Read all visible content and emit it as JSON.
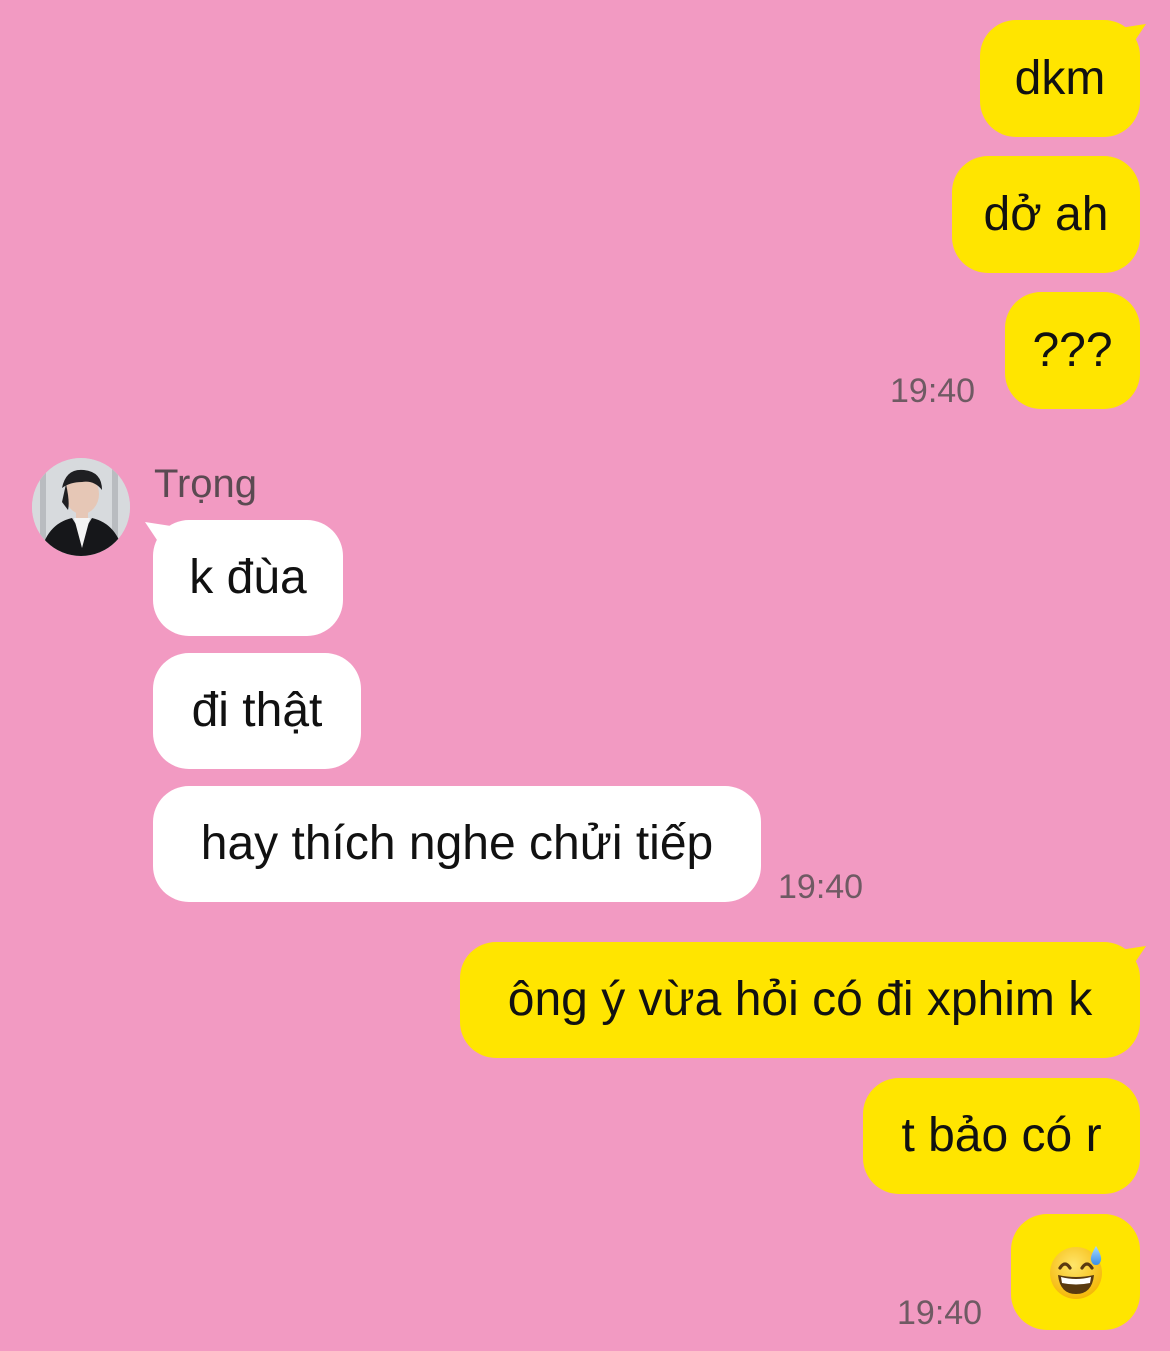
{
  "chat": {
    "contact_name": "Trọng",
    "messages": [
      {
        "side": "out",
        "text": "dkm"
      },
      {
        "side": "out",
        "text": "dở ah"
      },
      {
        "side": "out",
        "text": "???",
        "time": "19:40"
      },
      {
        "side": "in",
        "text": "k đùa"
      },
      {
        "side": "in",
        "text": "đi thật"
      },
      {
        "side": "in",
        "text": "hay thích nghe chửi tiếp",
        "time": "19:40"
      },
      {
        "side": "out",
        "text": "ông ý vừa hỏi có đi xphim k"
      },
      {
        "side": "out",
        "text": "t bảo có r"
      },
      {
        "side": "out",
        "emoji": "grinning-face-with-sweat",
        "time": "19:40"
      }
    ]
  },
  "colors": {
    "background": "#f29ac2",
    "outgoing_bubble": "#ffe500",
    "incoming_bubble": "#ffffff",
    "timestamp": "#6f5a63"
  }
}
